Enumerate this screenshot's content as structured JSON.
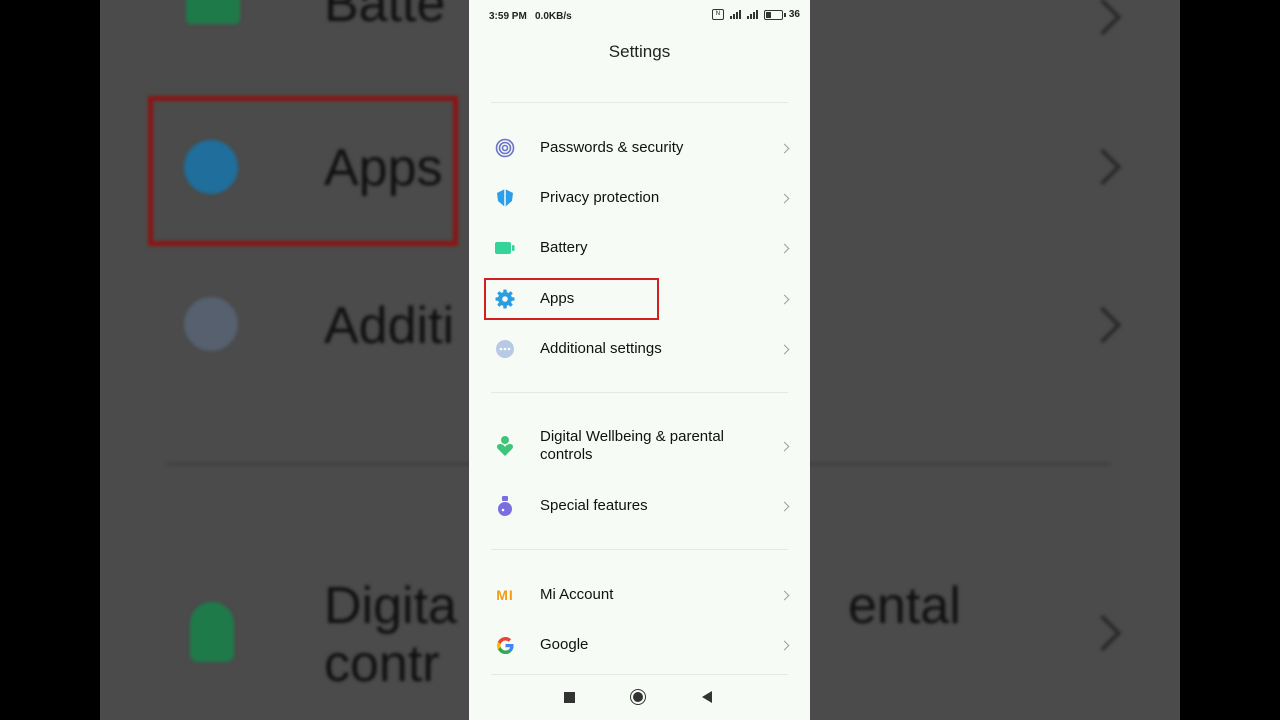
{
  "status_bar": {
    "time": "3:59 PM",
    "speed": "0.0KB/s",
    "battery": "36",
    "nfc": "N",
    "battery_level": 0.36
  },
  "header": {
    "title": "Settings"
  },
  "items": [
    {
      "label": "Passwords & security",
      "icon": "fingerprint-icon",
      "color": "#6b73c9"
    },
    {
      "label": "Privacy protection",
      "icon": "shield-icon",
      "color": "#2d9fe8"
    },
    {
      "label": "Battery",
      "icon": "battery-icon",
      "color": "#34d399"
    },
    {
      "label": "Apps",
      "icon": "gear-icon",
      "color": "#2a9de3"
    },
    {
      "label": "Additional settings",
      "icon": "more-dots-icon",
      "color": "#b8c9e6"
    },
    {
      "label": "Digital Wellbeing & parental controls",
      "icon": "wellbeing-icon",
      "color": "#3fc57a"
    },
    {
      "label": "Special features",
      "icon": "potion-icon",
      "color": "#7b6fe0"
    },
    {
      "label": "Mi Account",
      "icon": "mi-icon",
      "color": "#f39c12",
      "logo_text": "MI"
    },
    {
      "label": "Google",
      "icon": "google-icon",
      "color": "#4285f4"
    }
  ],
  "background_zoom": {
    "labels": [
      "Batte",
      "Apps",
      "Additi",
      "Digita",
      "contr",
      "ental"
    ]
  },
  "highlight_color": "#d21f1f"
}
